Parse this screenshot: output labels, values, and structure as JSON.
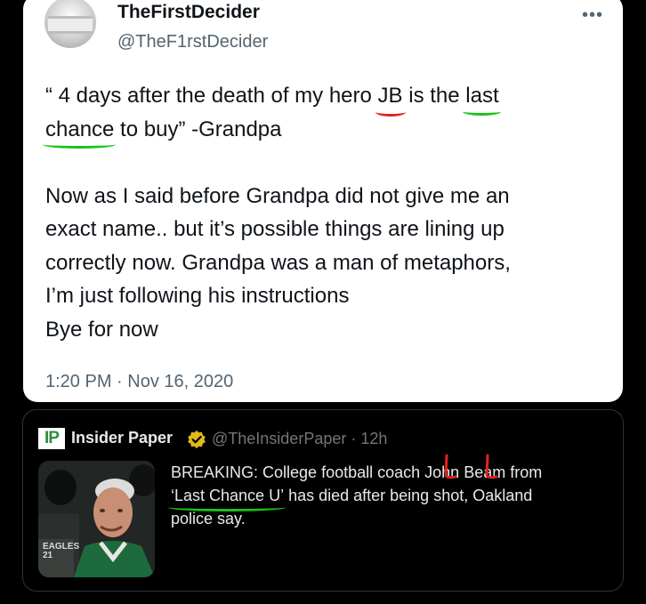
{
  "tweet": {
    "display_name": "TheFirstDecider",
    "handle": "@TheF1rstDecider",
    "more_icon": "more-horizontal-icon",
    "line1_a": "“ 4 days after the death of my hero ",
    "line1_hl_jb": "JB",
    "line1_b": " is the ",
    "line1_hl_last": "last",
    "line2_hl_chance": "chance",
    "line2_b": " to buy” -Grandpa",
    "para2": [
      "Now as I said before Grandpa did not give me an",
      "exact name.. but it’s possible things are lining up",
      "correctly now. Grandpa was a man of metaphors,",
      "I’m just following his instructions",
      "Bye for now"
    ],
    "timestamp": "1:20 PM · Nov 16, 2020"
  },
  "quote": {
    "logo_text": "IP",
    "name": "Insider Paper",
    "verified_icon": "verified-badge-icon",
    "handle_time": "@TheInsiderPaper · 12h",
    "thumbnail_icon": "coach-photo",
    "jersey_text": "EAGLES 21",
    "line1_a": "BREAKING: College football coach ",
    "line1_john": "John",
    "line1_b": " Beam from",
    "line2_hl": "‘Last Chance U’",
    "line2_b": " has died after being shot, Oakland",
    "line3": "police say."
  },
  "colors": {
    "background": "#000000",
    "card_white": "#ffffff",
    "text_dark": "#0f1419",
    "text_muted": "#536471",
    "annotation_red": "#e0231b",
    "annotation_green": "#19c21b",
    "verified_gold": "#e2b719"
  }
}
